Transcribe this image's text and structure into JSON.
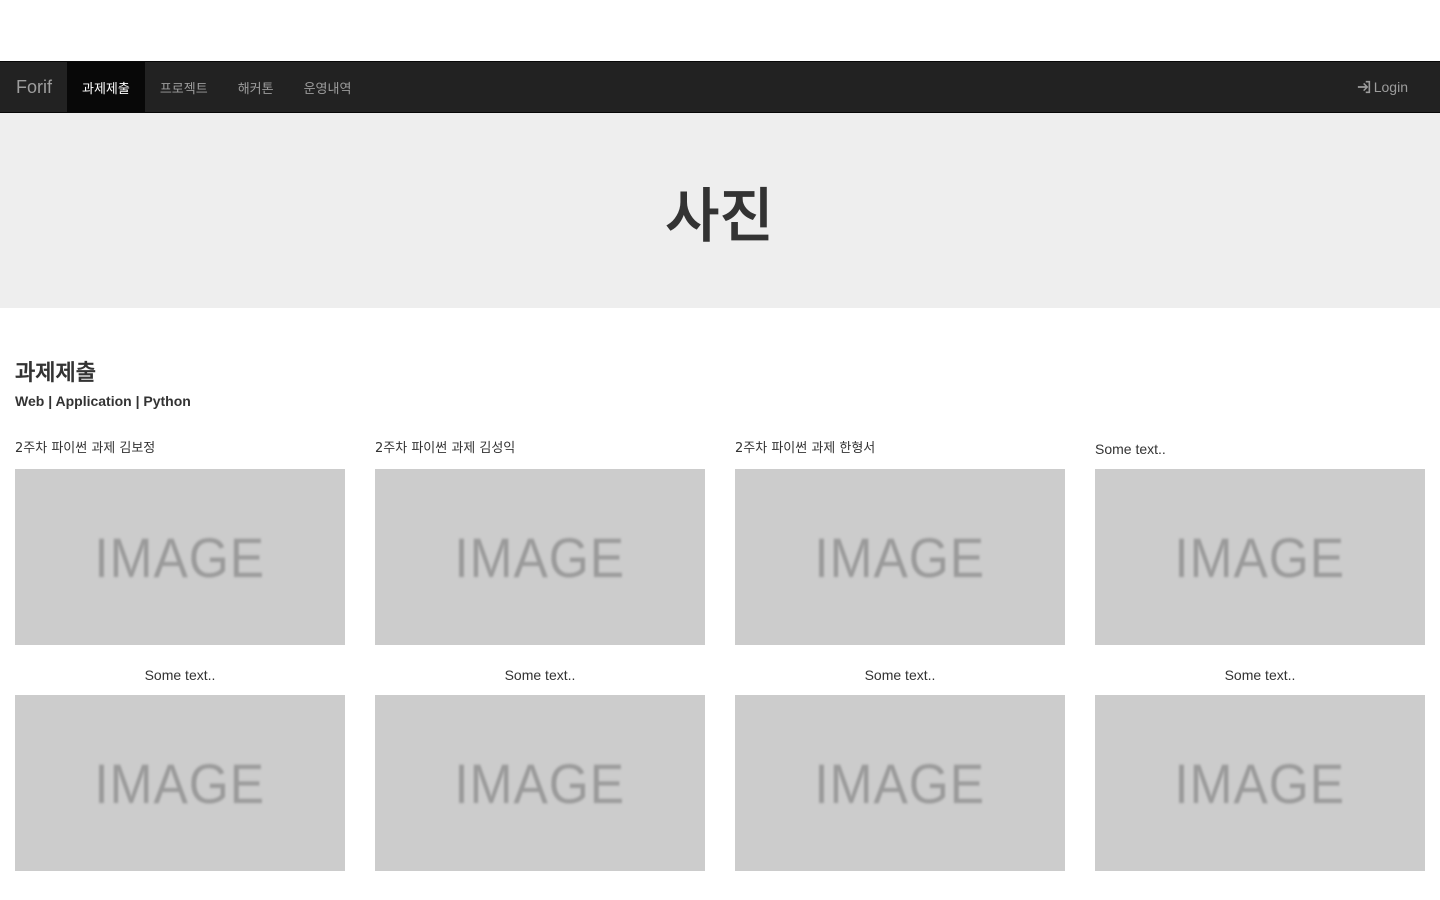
{
  "navbar": {
    "brand": "Forif",
    "items": [
      {
        "label": "과제제출",
        "active": true
      },
      {
        "label": "프로젝트",
        "active": false
      },
      {
        "label": "해커톤",
        "active": false
      },
      {
        "label": "운영내역",
        "active": false
      }
    ],
    "login_label": "Login",
    "login_icon": "log-in-icon"
  },
  "jumbotron": {
    "title": "사진"
  },
  "section": {
    "title": "과제제출",
    "tags": "Web | Application | Python"
  },
  "gallery": {
    "placeholder_text": "IMAGE",
    "row1": [
      {
        "caption": "2주차 파이썬 과제 김보정"
      },
      {
        "caption": "2주차 파이썬 과제 김성익"
      },
      {
        "caption": "2주차 파이썬 과제 한형서"
      },
      {
        "caption": "Some text.."
      }
    ],
    "row2": [
      {
        "caption": "Some text.."
      },
      {
        "caption": "Some text.."
      },
      {
        "caption": "Some text.."
      },
      {
        "caption": "Some text.."
      }
    ]
  },
  "colors": {
    "navbar_bg": "#222222",
    "navbar_active_bg": "#080808",
    "jumbotron_bg": "#eeeeee",
    "image_placeholder_bg": "#cccccc"
  }
}
